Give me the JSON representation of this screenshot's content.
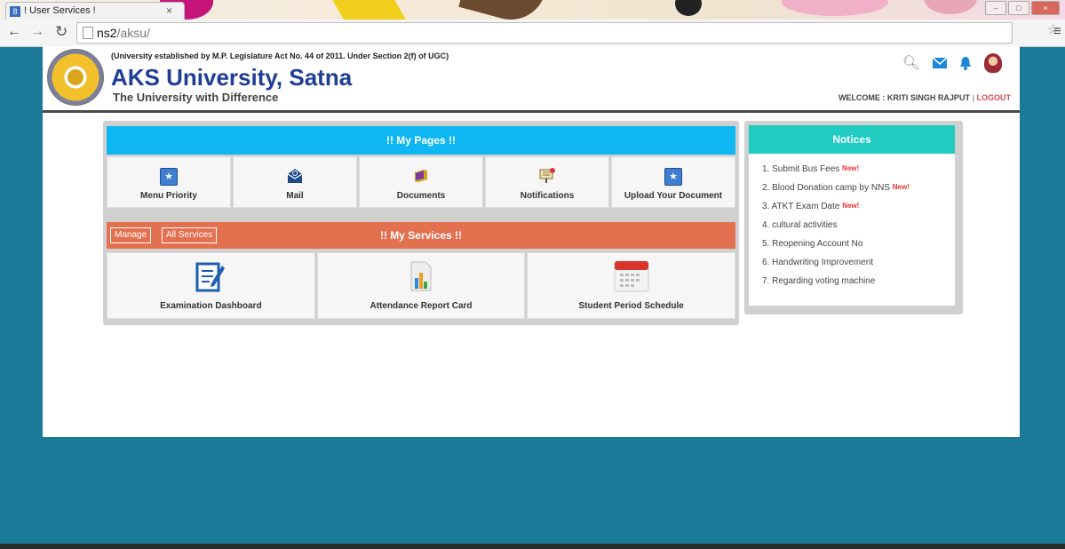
{
  "browser": {
    "tab_title": "! User Services !",
    "tab_close": "×",
    "url_host": "ns2",
    "url_path": "/aksu/"
  },
  "header": {
    "establishment": "(University established by M.P. Legislature Act No. 44 of 2011. Under Section 2(f) of UGC)",
    "university_name": "AKS University, Satna",
    "tagline": "The University with Difference",
    "welcome": "WELCOME : KRITI SINGH RAJPUT",
    "separator": "|",
    "logout": "LOGOUT"
  },
  "my_pages": {
    "title": "!! My Pages !!",
    "items": [
      {
        "label": "Menu Priority",
        "icon": "star-box-icon"
      },
      {
        "label": "Mail",
        "icon": "envelope-icon"
      },
      {
        "label": "Documents",
        "icon": "folder-icon"
      },
      {
        "label": "Notifications",
        "icon": "notice-board-icon"
      },
      {
        "label": "Upload Your Document",
        "icon": "star-box-icon"
      }
    ]
  },
  "my_services": {
    "title": "!! My Services !!",
    "manage": "Manage",
    "all_services": "All Services",
    "items": [
      {
        "label": "Examination Dashboard",
        "icon": "edit-document-icon"
      },
      {
        "label": "Attendance Report Card",
        "icon": "bar-chart-icon"
      },
      {
        "label": "Student Period Schedule",
        "icon": "calendar-icon"
      }
    ]
  },
  "notices": {
    "title": "Notices",
    "new_badge": "New!",
    "items": [
      {
        "text": "1. Submit Bus Fees",
        "is_new": true
      },
      {
        "text": "2. Blood Donation camp by NNS",
        "is_new": true
      },
      {
        "text": "3. ATKT Exam Date",
        "is_new": true
      },
      {
        "text": "4. cultural activities",
        "is_new": false
      },
      {
        "text": "5. Reopening Account No",
        "is_new": false
      },
      {
        "text": "6. Handwriting Improvement",
        "is_new": false
      },
      {
        "text": "7. Regarding voting machine",
        "is_new": false
      }
    ]
  },
  "colors": {
    "background": "#1a7a97",
    "my_pages_bar": "#0fb7f2",
    "services_bar": "#e37150",
    "notices_bar": "#20cbc0",
    "brand_blue": "#1e3e96",
    "logout_red": "#d64a4a"
  }
}
